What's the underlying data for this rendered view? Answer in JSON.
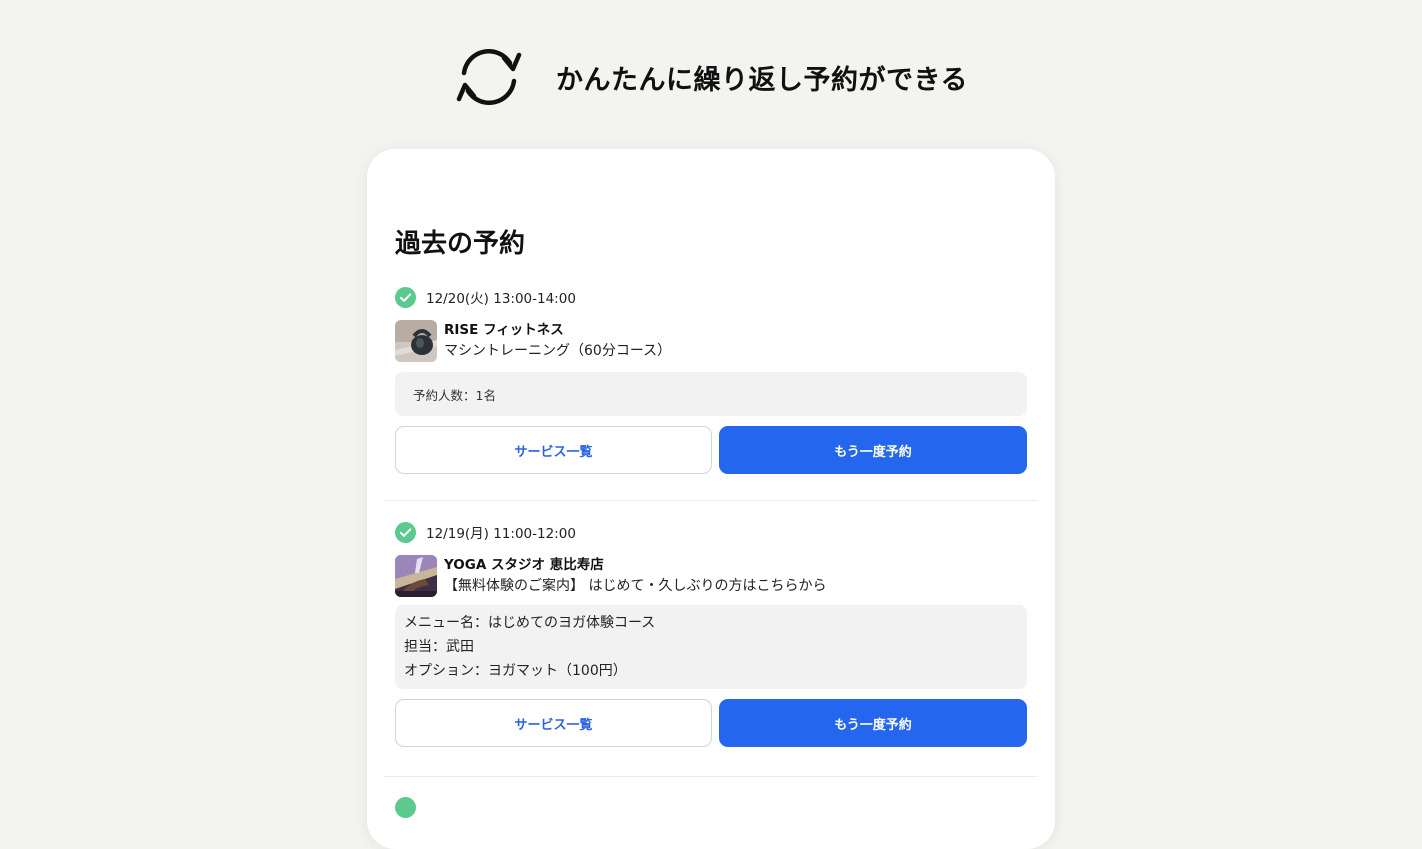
{
  "hero": {
    "title": "かんたんに繰り返し予約ができる",
    "icon": "refresh-icon"
  },
  "card": {
    "title": "過去の予約"
  },
  "colors": {
    "accent": "#2566ee",
    "check": "#5cc98e",
    "background": "#f3f3ef"
  },
  "bookings": [
    {
      "date": "12/20(火) 13:00-14:00",
      "shop_name": "RISE フィットネス",
      "service": "マシントレーニング（60分コース）",
      "details": [
        "予約人数：1名"
      ],
      "thumbnail": "kettlebell-image",
      "service_list_label": "サービス一覧",
      "rebook_label": "もう一度予約"
    },
    {
      "date": "12/19(月) 11:00-12:00",
      "shop_name": "YOGA スタジオ 恵比寿店",
      "service": "【無料体験のご案内】 はじめて・久しぶりの方はこちらから",
      "details": [
        "メニュー名：はじめてのヨガ体験コース",
        "担当：武田",
        "オプション：ヨガマット（100円）"
      ],
      "thumbnail": "yoga-image",
      "service_list_label": "サービス一覧",
      "rebook_label": "もう一度予約"
    }
  ]
}
